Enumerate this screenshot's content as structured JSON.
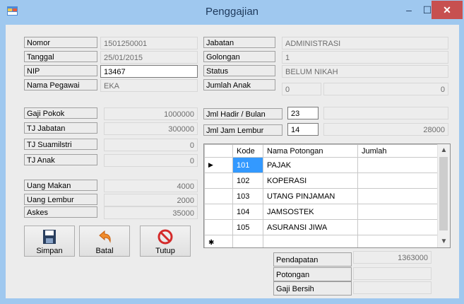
{
  "window": {
    "title": "Penggajian",
    "minimize": "–",
    "maximize": "☐",
    "close": "✕"
  },
  "left": {
    "nomor": {
      "label": "Nomor",
      "value": "1501250001"
    },
    "tanggal": {
      "label": "Tanggal",
      "value": "25/01/2015"
    },
    "nip": {
      "label": "NIP",
      "value": "13467"
    },
    "nama": {
      "label": "Nama Pegawai",
      "value": "EKA"
    },
    "gaji_pokok": {
      "label": "Gaji Pokok",
      "value": "1000000"
    },
    "tj_jabatan": {
      "label": "TJ Jabatan",
      "value": "300000"
    },
    "tj_suami": {
      "label": "TJ Suamilstri",
      "value": "0"
    },
    "tj_anak": {
      "label": "TJ Anak",
      "value": "0"
    },
    "uang_makan": {
      "label": "Uang Makan",
      "value": "4000"
    },
    "uang_lembur": {
      "label": "Uang Lembur",
      "value": "2000"
    },
    "askes": {
      "label": "Askes",
      "value": "35000"
    }
  },
  "right": {
    "jabatan": {
      "label": "Jabatan",
      "value": "ADMINISTRASI"
    },
    "golongan": {
      "label": "Golongan",
      "value": "1"
    },
    "status": {
      "label": "Status",
      "value": "BELUM NIKAH"
    },
    "jumlah_anak": {
      "label": "Jumlah Anak",
      "value": "0",
      "extra": "0"
    },
    "hadir": {
      "label": "Jml Hadir / Bulan",
      "value": "23",
      "extra": ""
    },
    "lembur": {
      "label": "Jml Jam Lembur",
      "value": "14",
      "extra": "28000"
    }
  },
  "buttons": {
    "simpan": "Simpan",
    "batal": "Batal",
    "tutup": "Tutup"
  },
  "grid": {
    "headers": [
      "Kode",
      "Nama Potongan",
      "Jumlah"
    ],
    "rows": [
      {
        "kode": "101",
        "nama": "PAJAK",
        "jumlah": ""
      },
      {
        "kode": "102",
        "nama": "KOPERASI",
        "jumlah": ""
      },
      {
        "kode": "103",
        "nama": "UTANG PINJAMAN",
        "jumlah": ""
      },
      {
        "kode": "104",
        "nama": "JAMSOSTEK",
        "jumlah": ""
      },
      {
        "kode": "105",
        "nama": "ASURANSI JIWA",
        "jumlah": ""
      }
    ],
    "current_marker": "▶",
    "new_marker": "✱"
  },
  "summary": {
    "pendapatan": {
      "label": "Pendapatan",
      "value": "1363000"
    },
    "potongan": {
      "label": "Potongan",
      "value": ""
    },
    "gaji_bersih": {
      "label": "Gaji Bersih",
      "value": ""
    }
  },
  "icons": {
    "simpan": "save-icon",
    "batal": "undo-icon",
    "tutup": "no-entry-icon"
  }
}
